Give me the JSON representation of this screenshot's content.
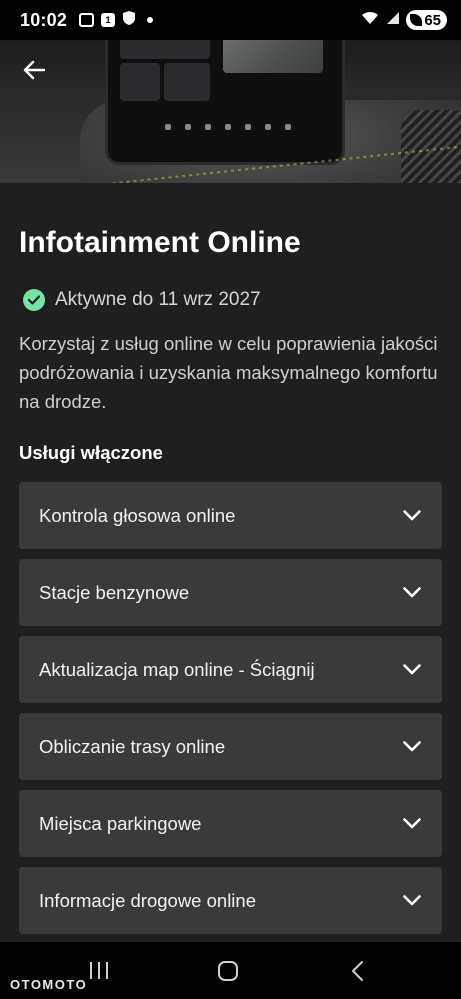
{
  "status_bar": {
    "time": "10:02",
    "notification_count": "1",
    "battery": "65"
  },
  "header": {
    "back_icon": "arrow-left-icon"
  },
  "page": {
    "title": "Infotainment Online",
    "status": {
      "icon": "check-circle-icon",
      "color": "#78e3a4",
      "text": "Aktywne do 11 wrz 2027"
    },
    "description": "Korzystaj z usług online w celu poprawienia jakości podróżowania i uzyskania maksymalnego komfortu na drodze.",
    "section_title": "Usługi włączone",
    "services": [
      {
        "label": "Kontrola głosowa online"
      },
      {
        "label": "Stacje benzynowe"
      },
      {
        "label": "Aktualizacja map online - Ściągnij"
      },
      {
        "label": "Obliczanie trasy online"
      },
      {
        "label": "Miejsca parkingowe"
      },
      {
        "label": "Informacje drogowe online"
      }
    ]
  },
  "watermark": "OTOMOTO",
  "colors": {
    "background": "#1f1f1f",
    "card": "#3a3a3a",
    "accent_green": "#78e3a4"
  }
}
